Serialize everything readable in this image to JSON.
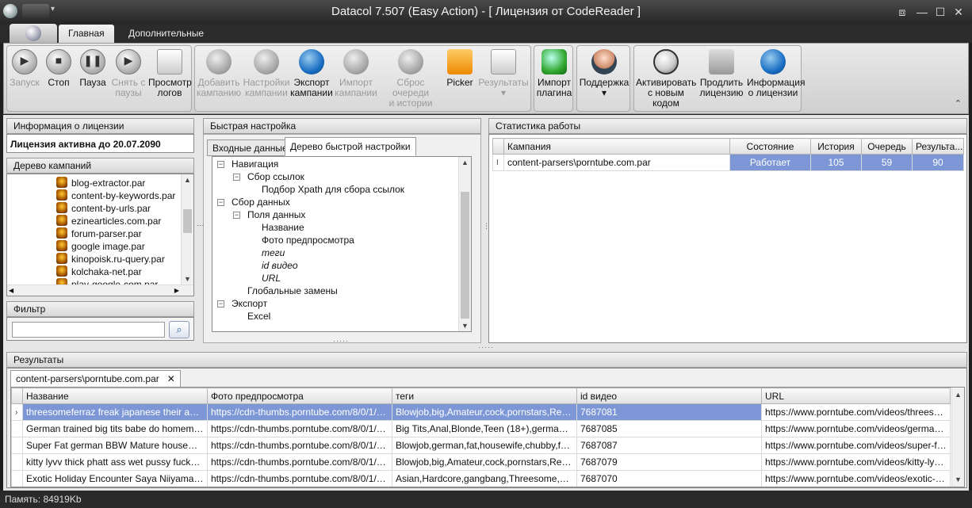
{
  "window": {
    "title": "Datacol 7.507 (Easy Action) - [ Лицензия от CodeReader ]"
  },
  "ribbon_tabs": [
    "Главная",
    "Дополнительные"
  ],
  "ribbon": {
    "run": "Запуск",
    "stop": "Стоп",
    "pause": "Пауза",
    "unpause_1": "Снять с",
    "unpause_2": "паузы",
    "logs_1": "Просмотр",
    "logs_2": "логов",
    "add_1": "Добавить",
    "add_2": "кампанию",
    "settings_1": "Настройки",
    "settings_2": "кампании",
    "export_1": "Экспорт",
    "export_2": "кампании",
    "import_1": "Импорт",
    "import_2": "кампании",
    "reset_1": "Сброс очереди",
    "reset_2": "и истории",
    "picker": "Picker",
    "results": "Результаты",
    "plugin_1": "Импорт",
    "plugin_2": "плагина",
    "support": "Поддержка",
    "activate_1": "Активировать",
    "activate_2": "с новым кодом",
    "extend_1": "Продлить",
    "extend_2": "лицензию",
    "info_1": "Информация",
    "info_2": "о лицензии",
    "icons": {
      "log": "log-file-icon"
    }
  },
  "license": {
    "header": "Информация о лицензии",
    "text": "Лицензия активна до 20.07.2090"
  },
  "campaign_tree": {
    "header": "Дерево кампаний",
    "items": [
      "blog-extractor.par",
      "content-by-keywords.par",
      "content-by-urls.par",
      "ezinearticles.com.par",
      "forum-parser.par",
      "google image.par",
      "kinopoisk.ru-query.par",
      "kolchaka-net.par",
      "play-google-com.par"
    ]
  },
  "filter": {
    "header": "Фильтр",
    "value": ""
  },
  "quick": {
    "header": "Быстрая настройка",
    "tab_input": "Входные данные",
    "tab_tree": "Дерево быстрой настройки",
    "nodes": [
      "Навигация",
      "Сбор ссылок",
      "Подбор Xpath для сбора ссылок",
      "Сбор данных",
      "Поля данных",
      "Название",
      "Фото предпросмотра",
      "теги",
      "id видео",
      "URL",
      "Глобальные замены",
      "Экспорт",
      "Excel"
    ]
  },
  "stats": {
    "header": "Статистика работы",
    "columns": [
      "Кампания",
      "Состояние",
      "История",
      "Очередь",
      "Результа..."
    ],
    "row": {
      "campaign": "content-parsers\\porntube.com.par",
      "state": "Работает",
      "history": "105",
      "queue": "59",
      "results": "90"
    }
  },
  "results": {
    "header": "Результаты",
    "tab": "content-parsers\\porntube.com.par",
    "columns": [
      "Название",
      "Фото предпросмотра",
      "теги",
      "id видео",
      "URL"
    ],
    "rows": [
      [
        "threesomeferraz freak japanese their anus p...",
        "https://cdn-thumbs.porntube.com/8/0/1/4/4...",
        "Blowjob,big,Amateur,cock,pornstars,Reality,...",
        "7687081",
        "https://www.porntube.com/videos/threesom..."
      ],
      [
        "German trained big tits babe do homemade a...",
        "https://cdn-thumbs.porntube.com/8/0/1/4/4...",
        "Big Tits,Anal,Blonde,Teen (18+),german,ass...",
        "7687085",
        "https://www.porntube.com/videos/german-tr..."
      ],
      [
        "Super Fat german BBW Mature housewife wi...",
        "https://cdn-thumbs.porntube.com/8/0/1/4/4...",
        "Blowjob,german,fat,housewife,chubby,fat w...",
        "7687087",
        "https://www.porntube.com/videos/super-fat..."
      ],
      [
        "kitty lyvv thick phatt ass wet pussy fucks ac...",
        "https://cdn-thumbs.porntube.com/8/0/1/4/4...",
        "Blowjob,big,Amateur,cock,pornstars,Reality,...",
        "7687079",
        "https://www.porntube.com/videos/kitty-lyvv-..."
      ],
      [
        "Exotic Holiday Encounter Saya Niiyama Oral...",
        "https://cdn-thumbs.porntube.com/8/0/1/4/4...",
        "Asian,Hardcore,gangbang,Threesome,Japan...",
        "7687070",
        "https://www.porntube.com/videos/exotic-hol..."
      ]
    ]
  },
  "status": {
    "memory": "Память: 84919Kb"
  }
}
